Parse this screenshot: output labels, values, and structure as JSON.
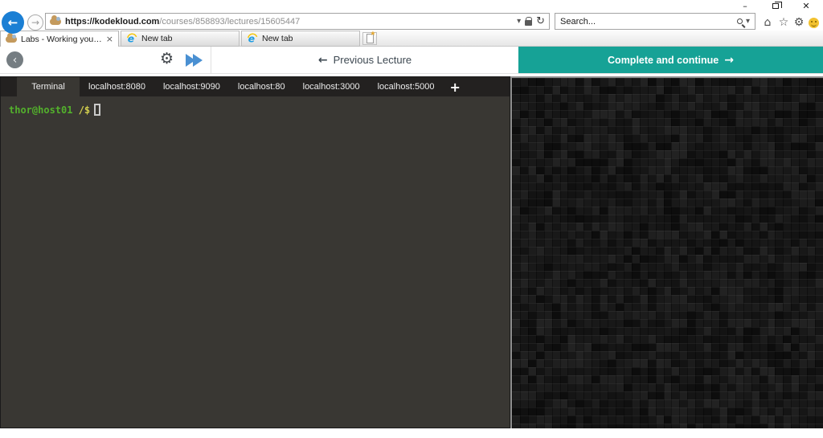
{
  "window_controls": {
    "minimize": "–",
    "close": "✕"
  },
  "browser": {
    "back_icon": "←",
    "forward_icon": "→",
    "address": {
      "host": "https://kodekloud.com",
      "path": "/courses/858893/lectures/15605447",
      "dropdown_icon": "▾",
      "refresh_icon": "↻"
    },
    "search": {
      "placeholder": "Search...",
      "dropdown_icon": "▾"
    },
    "tabs": [
      {
        "label": "Labs - Working your way th...",
        "close_icon": "×"
      },
      {
        "label": "New tab"
      },
      {
        "label": "New tab"
      }
    ]
  },
  "quickbar": {
    "home_icon": "⌂",
    "favorites_icon": "☆",
    "tools_icon": "⚙"
  },
  "lecture_bar": {
    "back_chevron": "‹",
    "gear_icon": "⚙",
    "previous_arrow": "←",
    "previous_label": "Previous Lecture",
    "complete_label": "Complete and continue",
    "complete_arrow": "→",
    "accent_color": "#16a296"
  },
  "terminal": {
    "active_tab": "Terminal",
    "tabs": [
      {
        "label": "Terminal"
      },
      {
        "label": "localhost:8080"
      },
      {
        "label": "localhost:9090"
      },
      {
        "label": "localhost:80"
      },
      {
        "label": "localhost:3000"
      },
      {
        "label": "localhost:5000"
      }
    ],
    "add_tab_icon": "+",
    "prompt_user": "thor@host01",
    "prompt_path": " /$",
    "colors": {
      "background": "#393733",
      "tab_bar": "#232120",
      "prompt_user_color": "#53b12c",
      "prompt_path_color": "#d3cf4e"
    }
  },
  "texture": {
    "palette": [
      "#101010",
      "#131313",
      "#161616",
      "#191919",
      "#1c1c1c",
      "#0d0d0d",
      "#1f1f1f",
      "#151515",
      "#222222",
      "#181818"
    ],
    "columns": 39,
    "rows": 44
  }
}
